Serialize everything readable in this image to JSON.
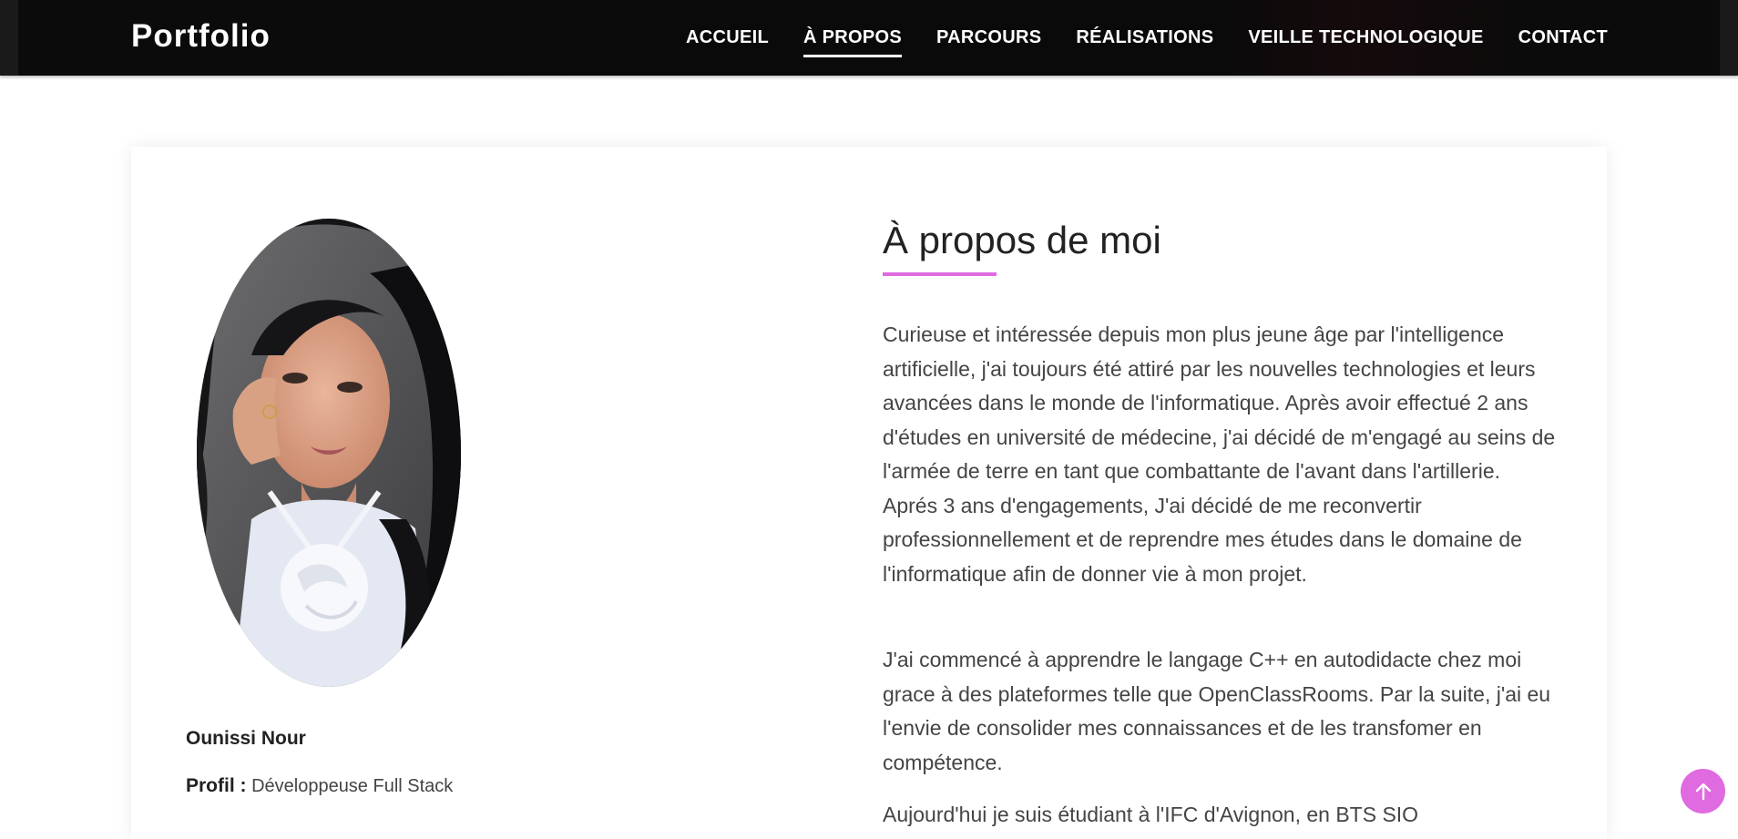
{
  "header": {
    "brand": "Portfolio",
    "nav": [
      {
        "label": "ACCUEIL",
        "active": false
      },
      {
        "label": "À PROPOS",
        "active": true
      },
      {
        "label": "PARCOURS",
        "active": false
      },
      {
        "label": "RÉALISATIONS",
        "active": false
      },
      {
        "label": "VEILLE TECHNOLOGIQUE",
        "active": false
      },
      {
        "label": "CONTACT",
        "active": false
      }
    ]
  },
  "profile": {
    "name": "Ounissi Nour",
    "profile_label": "Profil :",
    "profile_value": "Développeuse Full Stack"
  },
  "about": {
    "title": "À propos de moi",
    "paragraphs": [
      "Curieuse et intéressée depuis mon plus jeune âge par l'intelligence artificielle, j'ai toujours été attiré par les nouvelles technologies et leurs avancées dans le monde de l'informatique. Après avoir effectué 2 ans d'études en université de médecine, j'ai décidé de m'engagé au seins de l'armée de terre en tant que combattante de l'avant dans l'artillerie. Aprés 3 ans d'engagements, J'ai décidé de me reconvertir professionnellement et de reprendre mes études dans le domaine de l'informatique afin de donner vie à mon projet.",
      "J'ai commencé à apprendre le langage C++ en autodidacte chez moi grace à des plateformes telle que OpenClassRooms. Par la suite, j'ai eu l'envie de consolider mes connaissances et de les transfomer en compétence.",
      "Aujourd'hui je suis étudiant à l'IFC d'Avignon, en BTS SIO"
    ]
  },
  "colors": {
    "accent": "#e06ae0",
    "navbar": "#0b0b0b"
  },
  "icons": {
    "back_to_top": "arrow-up-icon"
  }
}
